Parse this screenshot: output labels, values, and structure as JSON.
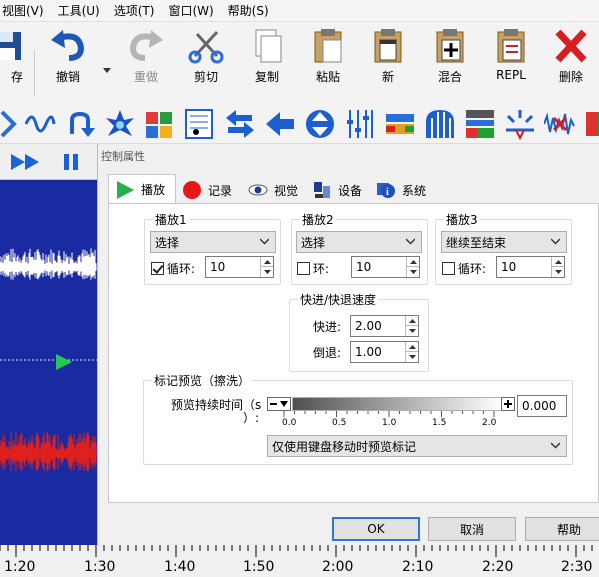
{
  "menu": [
    "视图(V)",
    "工具(U)",
    "选项(T)",
    "窗口(W)",
    "帮助(S)"
  ],
  "toolbar": {
    "save": "存",
    "undo": "撤销",
    "redo": "重做",
    "cut": "剪切",
    "copy": "复制",
    "paste": "粘贴",
    "new": "新",
    "mix": "混合",
    "repl": "REPL",
    "delete": "删除"
  },
  "effects_icons": [
    "envelope-icon",
    "sine-wave-icon",
    "reverse-icon",
    "burst-icon",
    "mix-icon",
    "music-notation-icon",
    "swap-icon",
    "left-arrow-icon",
    "vertical-split-icon",
    "equalizer-icon",
    "spectrum-icon",
    "tunnel-icon",
    "filter-icon",
    "spark-icon",
    "noise-icon",
    "amplify-icon"
  ],
  "dialog": {
    "title": "控制属性",
    "tabs": [
      {
        "label": "播放",
        "icon": "play-icon"
      },
      {
        "label": "记录",
        "icon": "record-icon"
      },
      {
        "label": "视觉",
        "icon": "eye-icon"
      },
      {
        "label": "设备",
        "icon": "device-icon"
      },
      {
        "label": "系统",
        "icon": "system-icon"
      }
    ],
    "play1": {
      "title": "播放1",
      "select": "选择",
      "loop_label": "循环:",
      "loop_checked": true,
      "loop_value": "10"
    },
    "play2": {
      "title": "播放2",
      "select": "选择",
      "loop_label": "环:",
      "loop_checked": false,
      "loop_value": "10"
    },
    "play3": {
      "title": "播放3",
      "select": "继续至结束",
      "loop_label": "循环:",
      "loop_checked": false,
      "loop_value": "10"
    },
    "speed": {
      "title": "快进/快退速度",
      "ff_label": "快进:",
      "ff_value": "2.00",
      "rw_label": "倒退:",
      "rw_value": "1.00"
    },
    "preview": {
      "title": "标记预览（擦洗）",
      "duration_label": "预览持续时间（s",
      "duration_label2": "）:",
      "ticks": [
        "0.0",
        "0.5",
        "1.0",
        "1.5",
        "2.0"
      ],
      "value": "0.000",
      "mode": "仅使用键盘移动时预览标记"
    },
    "buttons": {
      "ok": "OK",
      "cancel": "取消",
      "help": "帮助"
    }
  },
  "timeline": [
    "1:20",
    "1:30",
    "1:40",
    "1:50",
    "2:00",
    "2:10",
    "2:20",
    "2:30"
  ],
  "colors": {
    "wave_bg": "#1a2aa0",
    "wave_white": "#ffffff",
    "wave_red": "#e0201c",
    "accent": "#2b74d9"
  }
}
